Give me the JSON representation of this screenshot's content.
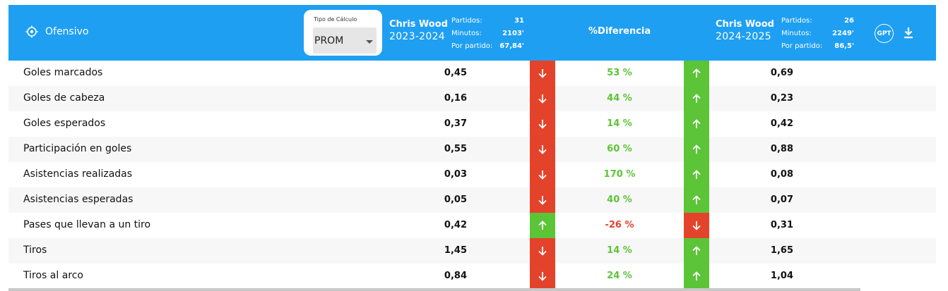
{
  "header": {
    "section": "Ofensivo",
    "calc_label": "Tipo de Cálculo",
    "calc_value": "PROM",
    "diff_title": "%Diferencia",
    "gpt_label": "GPT"
  },
  "player_left": {
    "name": "Chris Wood",
    "season": "2023-2024",
    "stats": [
      {
        "label": "Partidos:",
        "value": "31"
      },
      {
        "label": "Minutos:",
        "value": "2103'"
      },
      {
        "label": "Por partido:",
        "value": "67,84'"
      }
    ]
  },
  "player_right": {
    "name": "Chris Wood",
    "season": "2024-2025",
    "stats": [
      {
        "label": "Partidos:",
        "value": "26"
      },
      {
        "label": "Minutos:",
        "value": "2249'"
      },
      {
        "label": "Por partido:",
        "value": "86,5'"
      }
    ]
  },
  "rows": [
    {
      "metric": "Goles marcados",
      "v1": "0,45",
      "pct": "53 %",
      "v2": "0,69",
      "trend": "up"
    },
    {
      "metric": "Goles de cabeza",
      "v1": "0,16",
      "pct": "44 %",
      "v2": "0,23",
      "trend": "up"
    },
    {
      "metric": "Goles esperados",
      "v1": "0,37",
      "pct": "14 %",
      "v2": "0,42",
      "trend": "up"
    },
    {
      "metric": "Participación en goles",
      "v1": "0,55",
      "pct": "60 %",
      "v2": "0,88",
      "trend": "up"
    },
    {
      "metric": "Asistencias realizadas",
      "v1": "0,03",
      "pct": "170 %",
      "v2": "0,08",
      "trend": "up"
    },
    {
      "metric": "Asistencias esperadas",
      "v1": "0,05",
      "pct": "40 %",
      "v2": "0,07",
      "trend": "up"
    },
    {
      "metric": "Pases que llevan a un tiro",
      "v1": "0,42",
      "pct": "-26 %",
      "v2": "0,31",
      "trend": "down"
    },
    {
      "metric": "Tiros",
      "v1": "1,45",
      "pct": "14 %",
      "v2": "1,65",
      "trend": "up"
    },
    {
      "metric": "Tiros al arco",
      "v1": "0,84",
      "pct": "24 %",
      "v2": "1,04",
      "trend": "up"
    }
  ],
  "colors": {
    "header_bg": "#1e9ff2",
    "positive": "#5bc437",
    "negative": "#e4432b"
  },
  "icons": {
    "section": "target-icon",
    "download": "download-icon",
    "arrow_up": "arrow-up-icon",
    "arrow_down": "arrow-down-icon"
  }
}
